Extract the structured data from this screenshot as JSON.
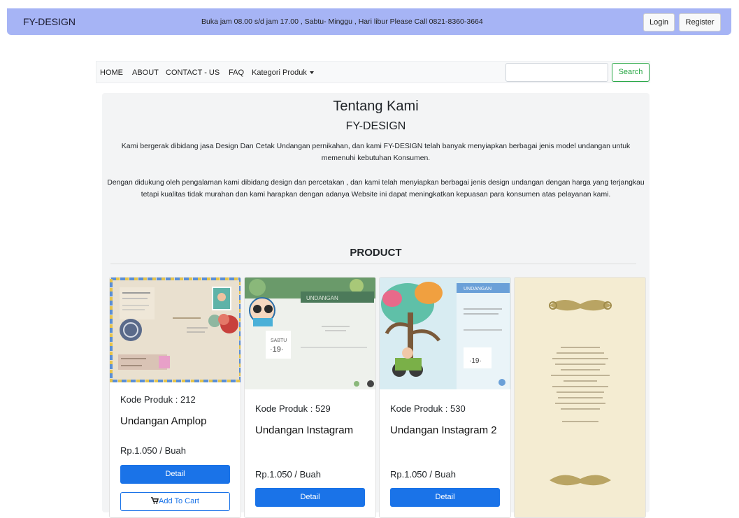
{
  "header": {
    "brand": "FY-DESIGN",
    "notice": "Buka jam 08.00 s/d jam 17.00 , Sabtu- Minggu , Hari libur Please Call 0821-8360-3664",
    "login_label": "Login",
    "register_label": "Register"
  },
  "nav": {
    "items": [
      "HOME",
      "ABOUT",
      "CONTACT - US",
      "FAQ",
      "Kategori Produk"
    ],
    "search_value": "",
    "search_button": "Search"
  },
  "about": {
    "title": "Tentang Kami",
    "subtitle": "FY-DESIGN",
    "paragraph1": "Kami bergerak dibidang jasa Design Dan Cetak Undangan pernikahan, dan kami FY-DESIGN telah banyak menyiapkan berbagai jenis model undangan untuk memenuhi kebutuhan Konsumen.",
    "paragraph2": "Dengan didukung oleh pengalaman kami dibidang design dan percetakan , dan kami telah menyiapkan berbagai jenis design undangan dengan harga yang terjangkau tetapi kualitas tidak murahan dan kami harapkan dengan adanya Website ini dapat meningkatkan kepuasan para konsumen atas pelayanan kami."
  },
  "products": {
    "heading": "PRODUCT",
    "cards": [
      {
        "code": "Kode Produk : 212",
        "name": "Undangan Amplop",
        "price": "Rp.1.050 / Buah",
        "detail_label": "Detail",
        "cart_label": "Add To Cart",
        "image": "envelope-invitation-image"
      },
      {
        "code": "Kode Produk : 529",
        "name": "Undangan Instagram",
        "price": "Rp.1.050 / Buah",
        "detail_label": "Detail",
        "image": "instagram-invitation-image"
      },
      {
        "code": "Kode Produk : 530",
        "name": "Undangan Instagram 2",
        "price": "Rp.1.050 / Buah",
        "detail_label": "Detail",
        "image": "instagram-invitation-2-image"
      },
      {
        "image": "vintage-invitation-image"
      }
    ]
  },
  "colors": {
    "topbar": "#a6b4f5",
    "primary": "#1a73e8",
    "success": "#28a745"
  }
}
